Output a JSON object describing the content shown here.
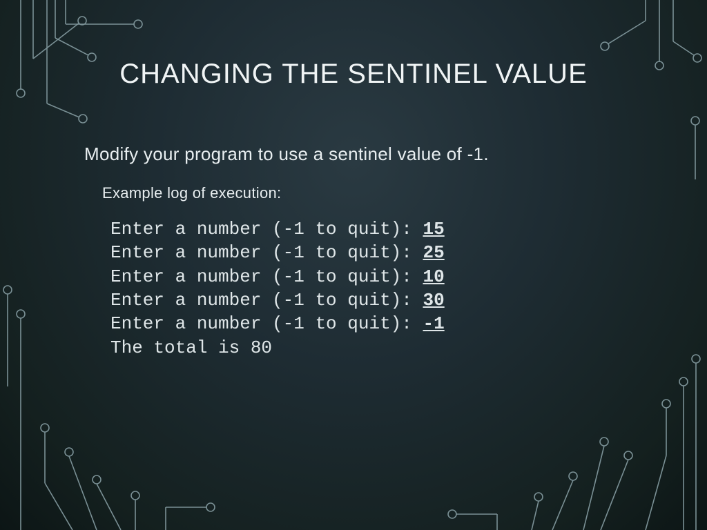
{
  "title": "CHANGING THE SENTINEL VALUE",
  "instruction": "Modify your program to use a sentinel value of -1.",
  "example_label": "Example log of execution:",
  "prompt_text": "Enter a number (-1 to quit): ",
  "log": {
    "inputs": [
      "15",
      "25",
      "10",
      "30",
      "-1"
    ],
    "result_line": "The total is 80"
  },
  "sentinel_value": -1,
  "total": 80
}
